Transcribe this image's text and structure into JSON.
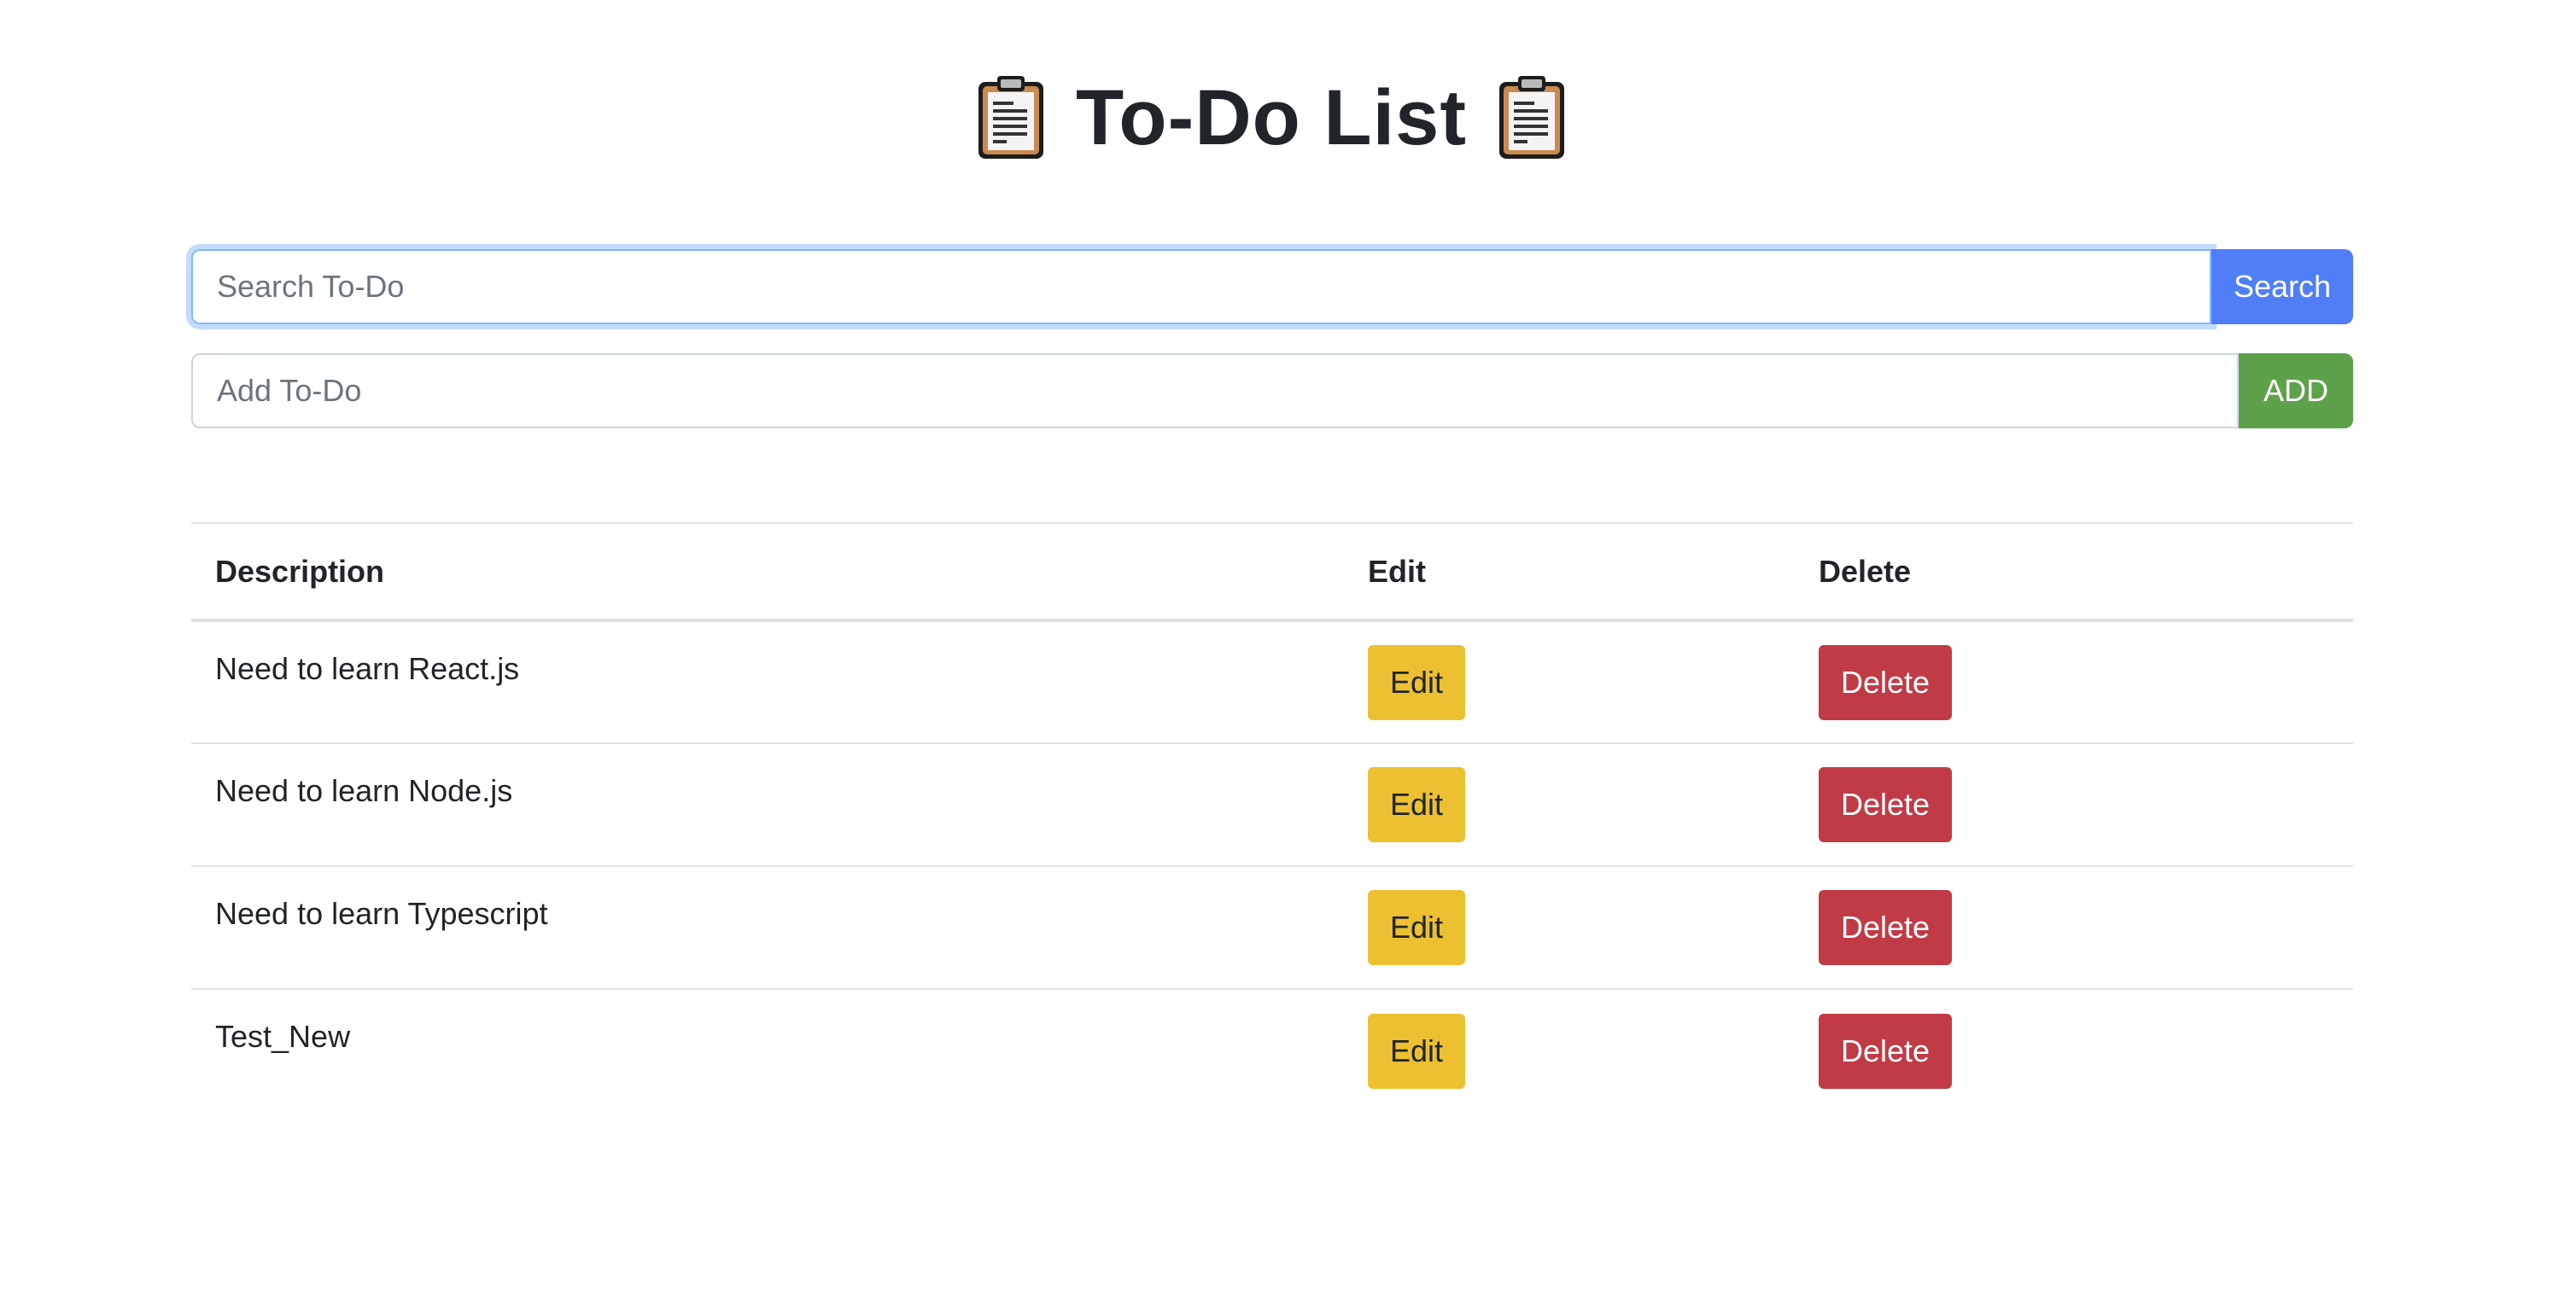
{
  "header": {
    "title": "To-Do List",
    "left_icon": "clipboard-icon",
    "right_icon": "clipboard-icon"
  },
  "search": {
    "placeholder": "Search To-Do",
    "value": "",
    "button_label": "Search"
  },
  "add": {
    "placeholder": "Add To-Do",
    "value": "",
    "button_label": "ADD"
  },
  "table": {
    "headers": [
      "Description",
      "Edit",
      "Delete"
    ],
    "rows": [
      {
        "description": "Need to learn React.js",
        "edit_label": "Edit",
        "delete_label": "Delete"
      },
      {
        "description": "Need to learn Node.js",
        "edit_label": "Edit",
        "delete_label": "Delete"
      },
      {
        "description": "Need to learn Typescript",
        "edit_label": "Edit",
        "delete_label": "Delete"
      },
      {
        "description": "Test_New",
        "edit_label": "Edit",
        "delete_label": "Delete"
      }
    ]
  },
  "colors": {
    "search_button": "#4f7ef7",
    "add_button": "#5da24a",
    "edit_button": "#ecc030",
    "delete_button": "#c03b46",
    "focus_ring": "#86b7fe"
  }
}
